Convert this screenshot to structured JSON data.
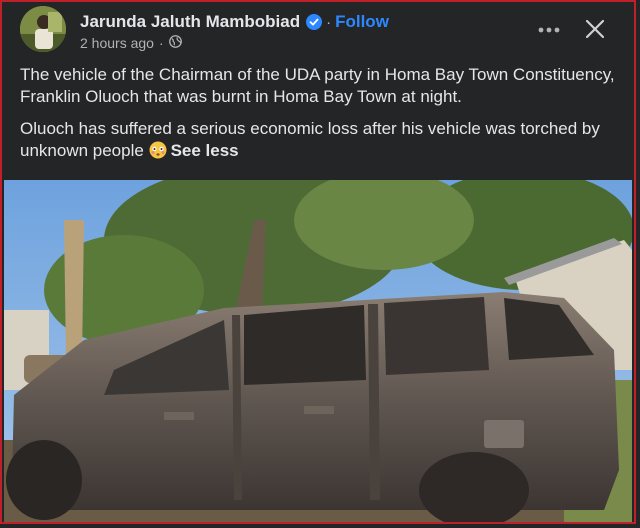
{
  "post": {
    "author": "Jarunda Jaluth Mambobiad",
    "separator": "·",
    "follow_label": "Follow",
    "time": "2 hours ago",
    "time_separator": "·",
    "audience_icon": "globe-icon",
    "verified_icon": "verified-badge-icon",
    "paragraphs": [
      "The vehicle of the Chairman of the UDA party in Homa Bay Town Constituency, Franklin Oluoch that was burnt in Homa Bay Town at night.",
      "Oluoch has suffered a serious economic loss after his vehicle was torched by unknown people"
    ],
    "emoji": "flushed-face-emoji",
    "see_less_label": "See less"
  },
  "controls": {
    "more_icon": "more-options-icon",
    "close_icon": "close-icon"
  },
  "colors": {
    "background": "#242526",
    "text": "#e4e6eb",
    "secondary": "#b0b3b8",
    "accent": "#2d88ff",
    "frame": "#c0202a"
  }
}
